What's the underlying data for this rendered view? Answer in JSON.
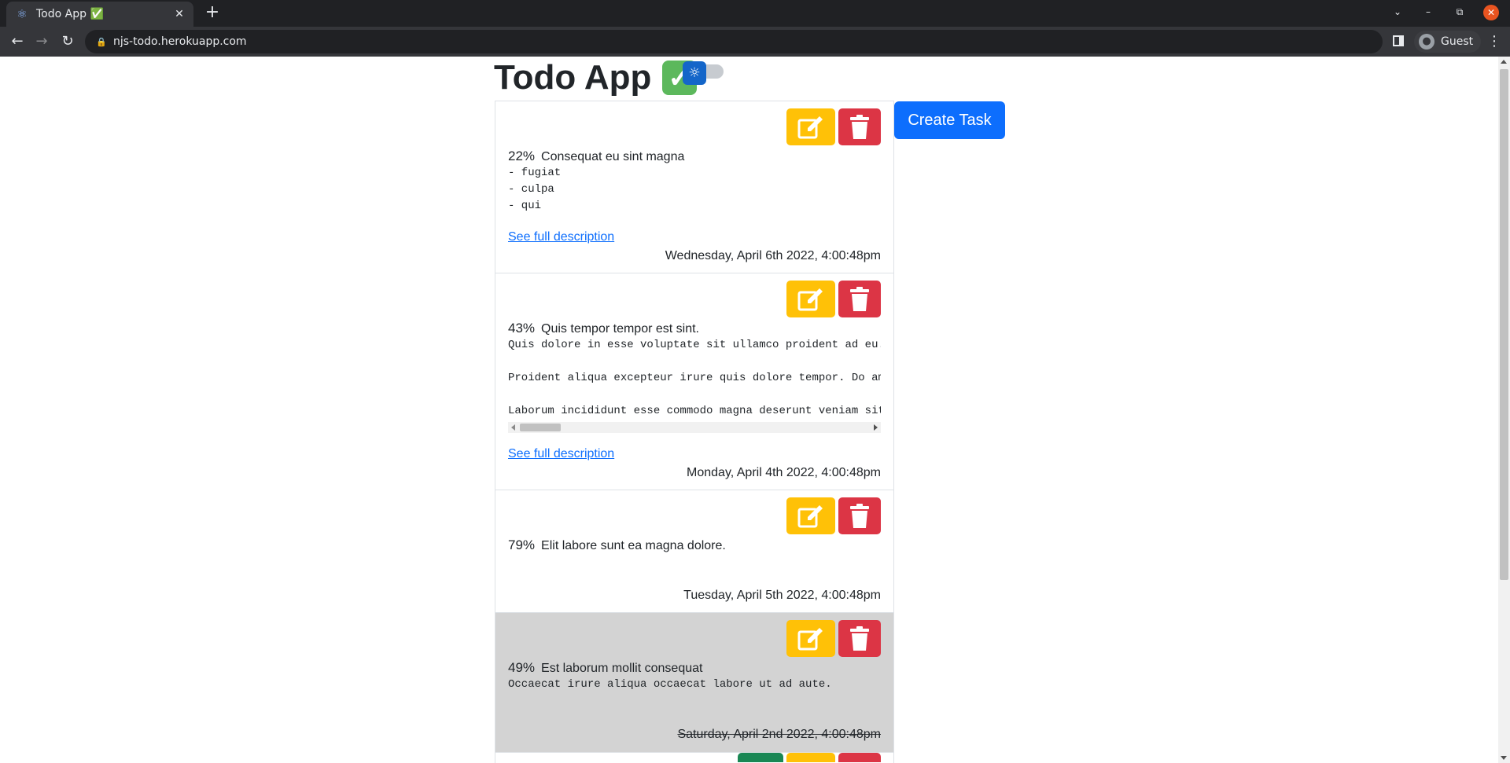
{
  "browser": {
    "tab_title": "Todo App ✅",
    "new_tab_icon": "plus-icon",
    "url": "njs-todo.herokuapp.com",
    "profile_label": "Guest"
  },
  "app": {
    "title": "Todo App",
    "title_emoji": "✓",
    "theme_icon": "sun-icon",
    "create_button": "Create Task"
  },
  "tasks": [
    {
      "percent": "22%",
      "title": "Consequat eu sint magna",
      "description": "- fugiat\n- culpa\n- qui",
      "link": "See full description",
      "date": "Wednesday, April 6th 2022, 4:00:48pm",
      "completed": false
    },
    {
      "percent": "43%",
      "title": "Quis tempor tempor est sint.",
      "description": "Quis dolore in esse voluptate sit ullamco proident ad eu.\n\nProident aliqua excepteur irure quis dolore tempor. Do am\n\nLaborum incididunt esse commodo magna deserunt veniam sit",
      "link": "See full description",
      "date": "Monday, April 4th 2022, 4:00:48pm",
      "completed": false
    },
    {
      "percent": "79%",
      "title": "Elit labore sunt ea magna dolore.",
      "description": "",
      "link": "",
      "date": "Tuesday, April 5th 2022, 4:00:48pm",
      "completed": false
    },
    {
      "percent": "49%",
      "title": "Est laborum mollit consequat",
      "description": "Occaecat irure aliqua occaecat labore ut ad aute.",
      "link": "",
      "date": "Saturday, April 2nd 2022, 4:00:48pm",
      "completed": true
    }
  ],
  "colors": {
    "edit": "#ffc107",
    "delete": "#dc3545",
    "complete": "#198754",
    "primary": "#0d6efd",
    "completed_bg": "#d3d3d3"
  }
}
